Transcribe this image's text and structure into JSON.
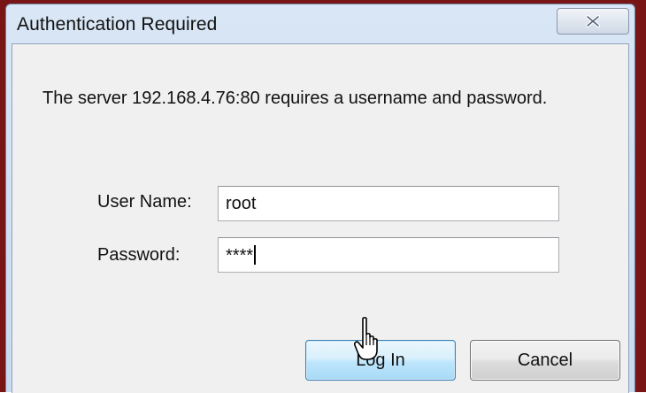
{
  "dialog": {
    "title": "Authentication Required",
    "message": "The server 192.168.4.76:80 requires a username and password."
  },
  "form": {
    "username_label": "User Name:",
    "username_value": "root",
    "password_label": "Password:",
    "password_value": "****"
  },
  "buttons": {
    "login_label": "Log In",
    "cancel_label": "Cancel"
  },
  "icons": {
    "close": "close-icon",
    "cursor": "hand-pointer-cursor-icon"
  },
  "colors": {
    "frame_accent": "#7a1515",
    "titlebar": "#d9e6f5",
    "dialog_body": "#f0f0f0",
    "login_button_border": "#3c7fb1"
  }
}
